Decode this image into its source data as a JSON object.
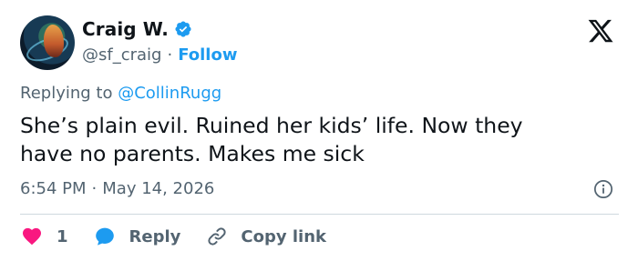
{
  "author": {
    "name": "Craig W.",
    "handle": "@sf_craig",
    "separator": "·",
    "follow_label": "Follow",
    "verified_icon": "verified-badge-icon",
    "avatar_icon": "avatar"
  },
  "reply": {
    "prefix": "Replying to",
    "mention": "@CollinRugg"
  },
  "tweet": {
    "text": "She’s plain evil. Ruined her kids’ life. Now they\nhave no parents. Makes me sick"
  },
  "meta": {
    "time": "6:54 PM",
    "separator": "·",
    "date": "May 14, 2026"
  },
  "actions": {
    "like_count": "1",
    "reply_label": "Reply",
    "copy_label": "Copy link"
  },
  "colors": {
    "accent": "#1d9bf0",
    "like": "#f91880",
    "text": "#0f1419",
    "muted": "#536471",
    "divider": "#cfd9de"
  }
}
